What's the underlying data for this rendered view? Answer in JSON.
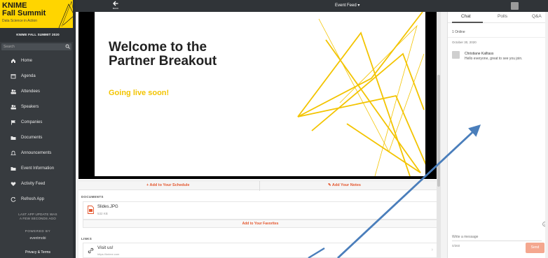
{
  "brand": {
    "line1": "KNIME",
    "line2": "Fall Summit",
    "tagline": "Data Science in Action"
  },
  "sidebar": {
    "event_name": "KNIME FALL SUMMIT 2020",
    "search_placeholder": "Search",
    "items": [
      {
        "label": "Home",
        "icon": "home-icon"
      },
      {
        "label": "Agenda",
        "icon": "calendar-icon"
      },
      {
        "label": "Attendees",
        "icon": "people-icon"
      },
      {
        "label": "Speakers",
        "icon": "speaker-icon"
      },
      {
        "label": "Companies",
        "icon": "flag-icon"
      },
      {
        "label": "Documents",
        "icon": "folder-icon"
      },
      {
        "label": "Announcements",
        "icon": "bell-icon"
      },
      {
        "label": "Event Information",
        "icon": "folder-icon"
      },
      {
        "label": "Activity Feed",
        "icon": "heart-icon"
      },
      {
        "label": "Refresh App",
        "icon": "refresh-icon"
      }
    ],
    "update_note_1": "LAST APP UPDATE WAS",
    "update_note_2": "A FEW SECONDS AGO",
    "powered_by": "POWERED BY",
    "powered_logo": "eventmobi",
    "privacy": "Privacy & Terms"
  },
  "topbar": {
    "back_label": "BACK",
    "title": "Event Feed ▾"
  },
  "slide": {
    "heading_line1": "Welcome to the",
    "heading_line2": "Partner Breakout",
    "subtitle": "Going live soon!",
    "accent_color": "#f3c400"
  },
  "actions": {
    "schedule": "+ Add to Your Schedule",
    "notes": "✎ Add Your Notes"
  },
  "documents": {
    "section_label": "DOCUMENTS",
    "file_name": "Slides.JPG",
    "file_size": "532 KB",
    "favorites_label": "Add to Your Favorites"
  },
  "links": {
    "section_label": "LINKS",
    "title": "Visit us!",
    "url": "https://knime.com"
  },
  "chat": {
    "tabs": [
      "Chat",
      "Polls",
      "Q&A"
    ],
    "online": "1 Online",
    "date": "October 30, 2020",
    "message": {
      "author": "Christiane Kalltass",
      "text": "Hello everyone, great to see you join."
    },
    "input_placeholder": "Write a message",
    "char_count": "0/360",
    "send_label": "Send"
  },
  "colors": {
    "accent": "#e4572e",
    "brand": "#ffd500",
    "arrow": "#4a7ebb"
  }
}
